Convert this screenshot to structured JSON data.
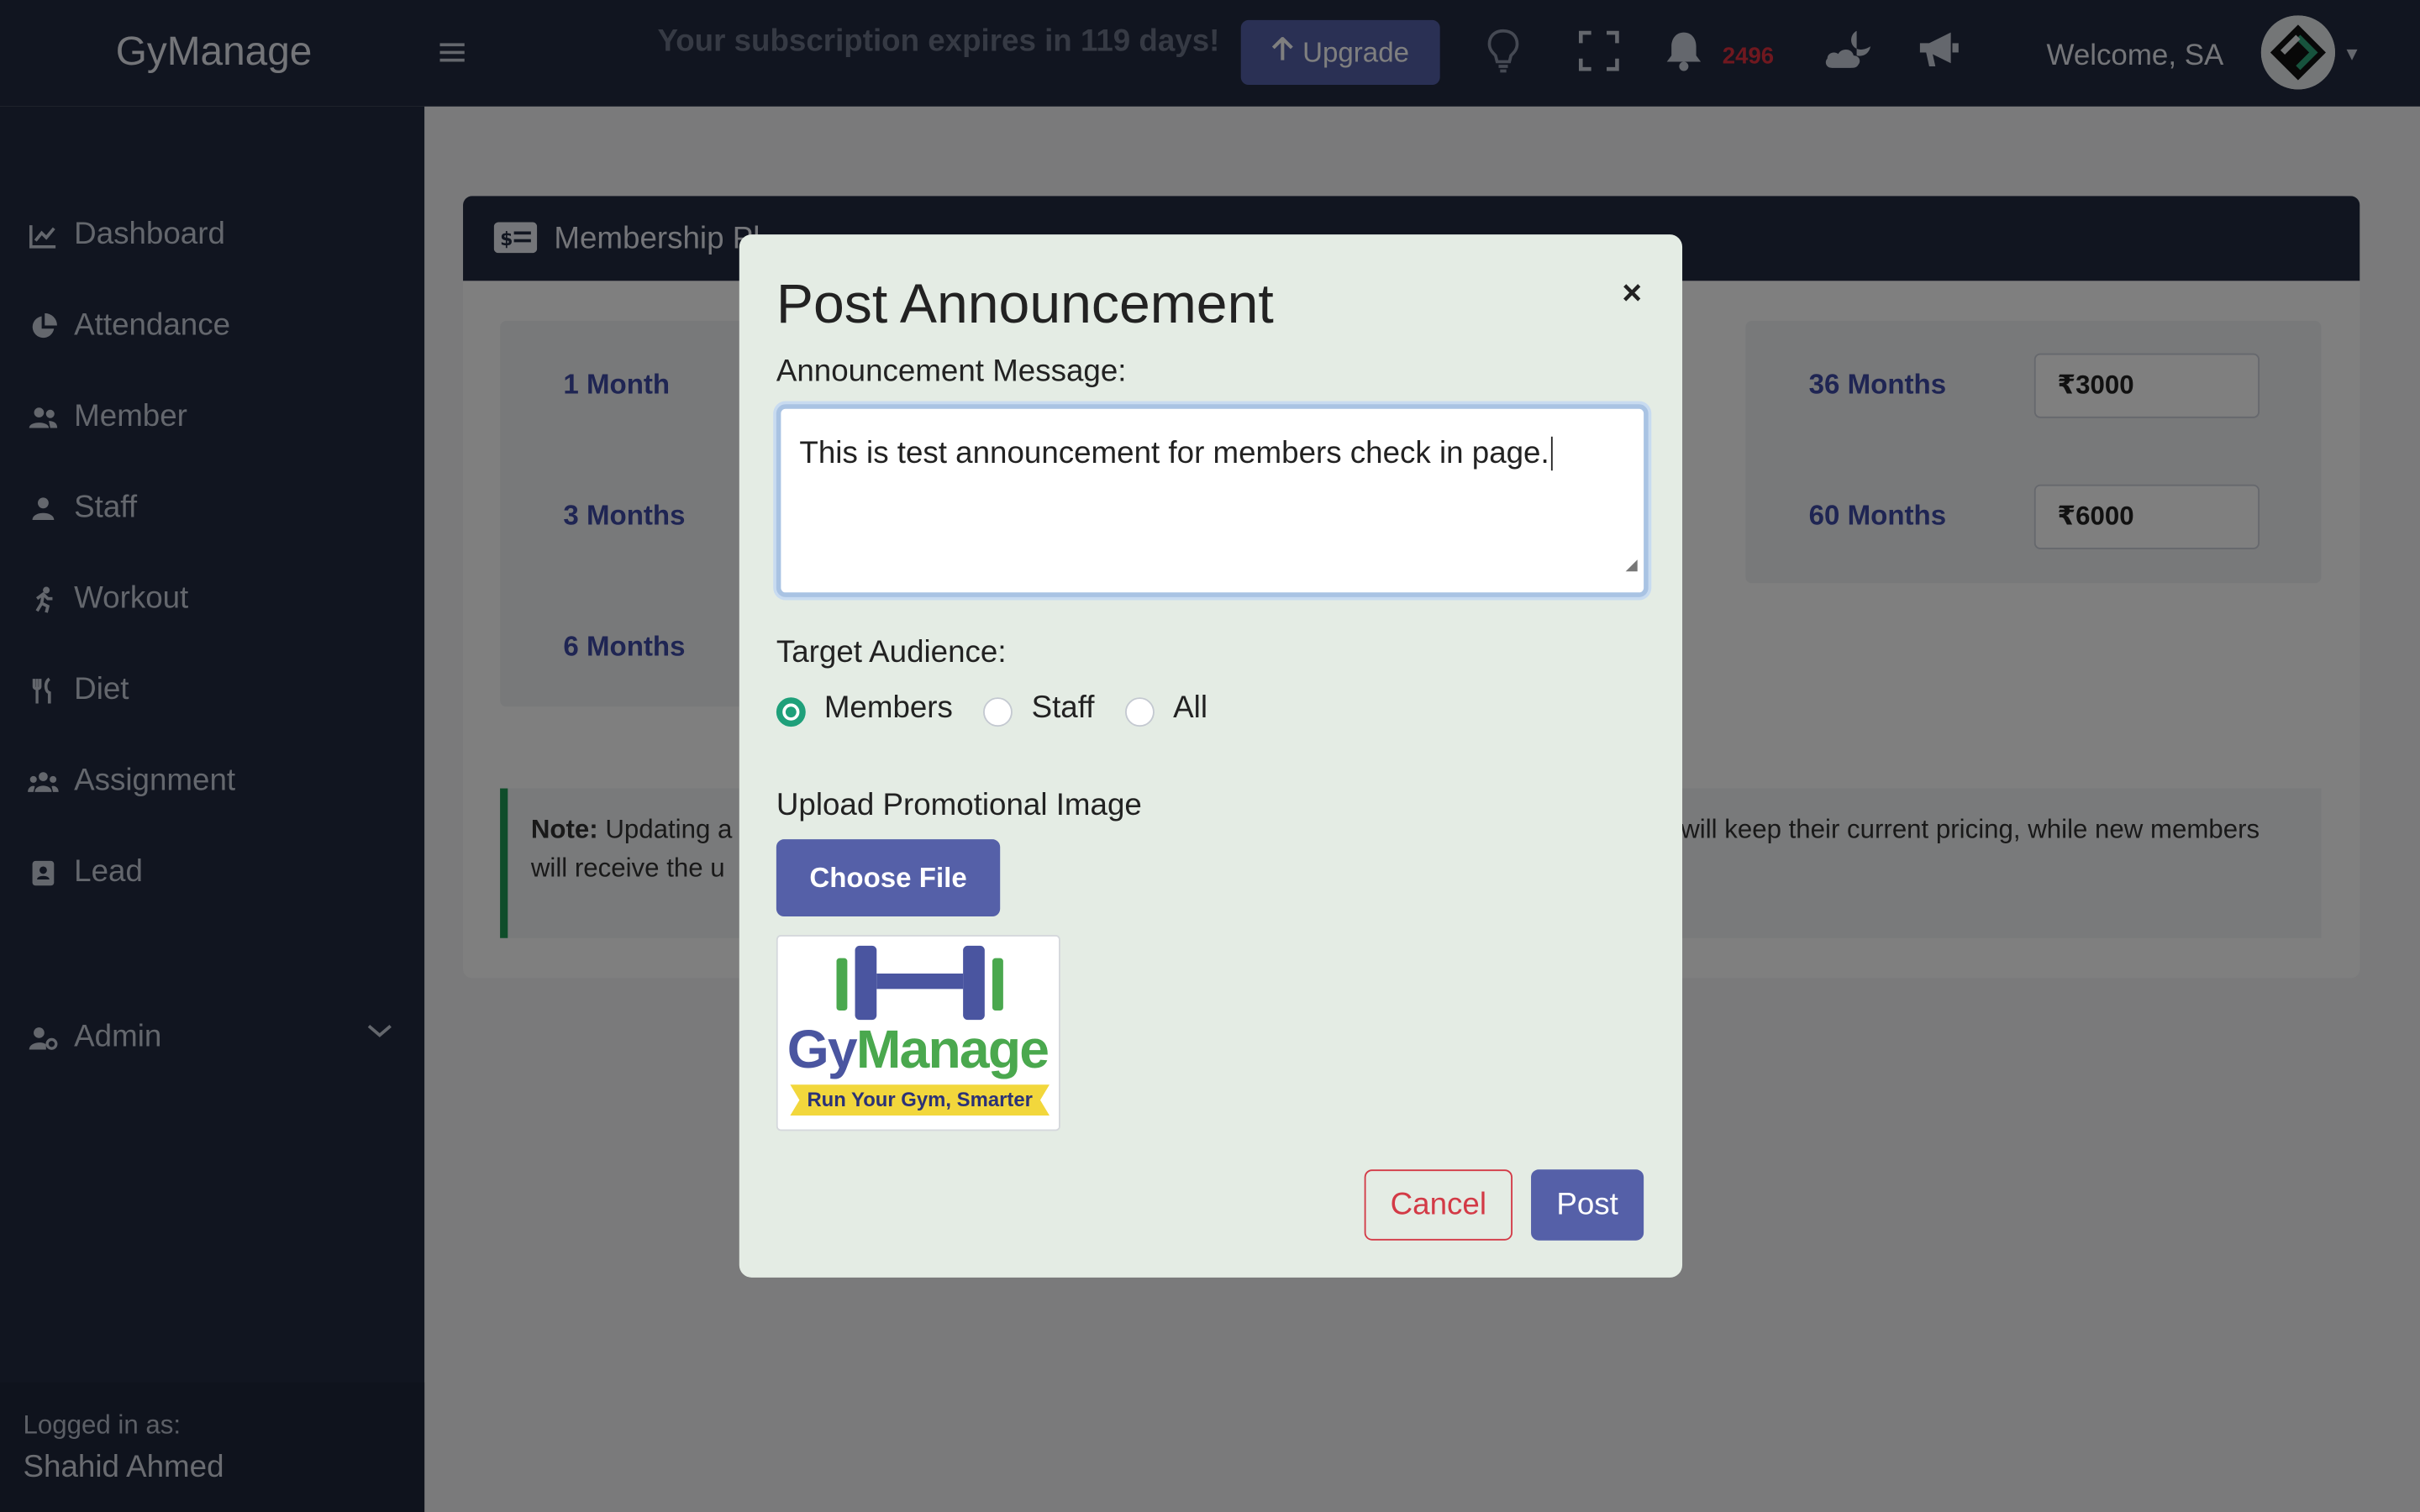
{
  "topbar": {
    "brand": "GyManage",
    "subscription_text": "Your subscription expires in 119 days!",
    "upgrade_label": "Upgrade",
    "notification_count": "2496",
    "welcome": "Welcome, SA"
  },
  "sidebar": {
    "items": [
      {
        "label": "Dashboard",
        "icon": "chart-line-icon"
      },
      {
        "label": "Attendance",
        "icon": "pie-chart-icon"
      },
      {
        "label": "Member",
        "icon": "users-icon"
      },
      {
        "label": "Staff",
        "icon": "user-icon"
      },
      {
        "label": "Workout",
        "icon": "running-icon"
      },
      {
        "label": "Diet",
        "icon": "utensils-icon"
      },
      {
        "label": "Assignment",
        "icon": "user-group-icon"
      },
      {
        "label": "Lead",
        "icon": "address-book-icon"
      }
    ],
    "admin_label": "Admin",
    "logged_in_label": "Logged in as:",
    "logged_in_name": "Shahid Ahmed"
  },
  "card": {
    "title": "Membership Pl",
    "plans": [
      {
        "label": "1 Month"
      },
      {
        "label": "3 Months"
      },
      {
        "label": "6 Months"
      },
      {
        "label": "36 Months",
        "price": "₹3000"
      },
      {
        "label": "60 Months",
        "price": "₹6000"
      }
    ],
    "note_bold": "Note:",
    "note_left_line1": "Updating a",
    "note_left_line2": "will receive the u",
    "note_right_line1": "will keep their current pricing, while new members"
  },
  "modal": {
    "title": "Post Announcement",
    "close_glyph": "×",
    "message_label": "Announcement Message:",
    "message_value": "This is test announcement for members check in page.",
    "audience_label": "Target Audience:",
    "audience_options": [
      "Members",
      "Staff",
      "All"
    ],
    "audience_selected": "Members",
    "upload_label": "Upload Promotional Image",
    "choose_file_label": "Choose File",
    "promo_brand_part1": "Gy",
    "promo_brand_part2": "Manage",
    "promo_tagline": "Run Your Gym, Smarter",
    "cancel_label": "Cancel",
    "post_label": "Post"
  },
  "colors": {
    "navy": "#222b40",
    "accent": "#5560a8",
    "success": "#1fa07a",
    "danger": "#d33a46",
    "modal_bg": "#e4ece4"
  }
}
